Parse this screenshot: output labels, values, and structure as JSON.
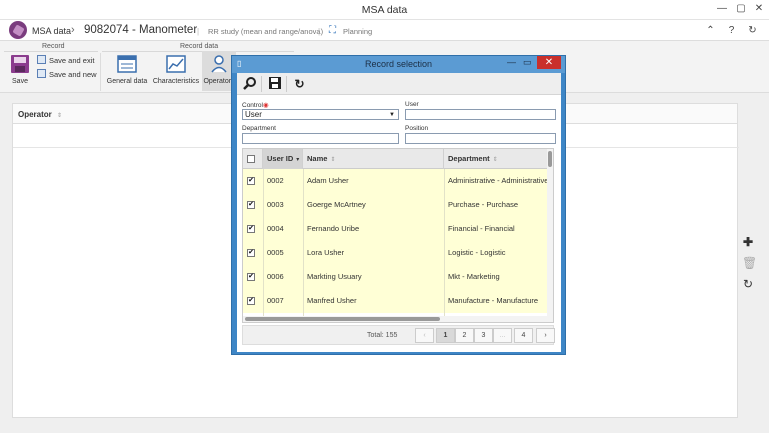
{
  "window": {
    "title": "MSA data"
  },
  "header": {
    "crumb1": "MSA data",
    "crumb2": "9082074 - Manometer",
    "tab1": "RR study (mean and range/anova)",
    "tab2": "Planning"
  },
  "ribbon": {
    "group_record": "Record",
    "group_record_data": "Record data",
    "save": "Save",
    "save_and_exit": "Save and exit",
    "save_and_new": "Save and new",
    "general_data": "General data",
    "characteristics": "Characteristics",
    "operators": "Operators"
  },
  "main": {
    "column_operator": "Operator"
  },
  "modal": {
    "title": "Record selection",
    "control_label": "Control",
    "control_value": "User",
    "user_label": "User",
    "user_value": "",
    "department_label": "Department",
    "department_value": "",
    "position_label": "Position",
    "position_value": "",
    "columns": {
      "user_id": "User ID",
      "name": "Name",
      "department": "Department"
    },
    "rows": [
      {
        "id": "0002",
        "name": "Adam Usher",
        "department": "Administrative - Administrative"
      },
      {
        "id": "0003",
        "name": "Goerge McArtney",
        "department": "Purchase - Purchase"
      },
      {
        "id": "0004",
        "name": "Fernando Uribe",
        "department": "Financial - Financial"
      },
      {
        "id": "0005",
        "name": "Lora Usher",
        "department": "Logistic - Logistic"
      },
      {
        "id": "0006",
        "name": "Markting Usuary",
        "department": "Mkt - Marketing"
      },
      {
        "id": "0007",
        "name": "Manfred Usher",
        "department": "Manufacture - Manufacture"
      }
    ],
    "total": "Total: 155",
    "pages": [
      "1",
      "2",
      "3",
      "...",
      "4"
    ],
    "prev": "‹",
    "next": "›"
  },
  "colors": {
    "modal_frame": "#3e86c6",
    "row_bg": "#ffffd6",
    "close": "#c9302c"
  }
}
